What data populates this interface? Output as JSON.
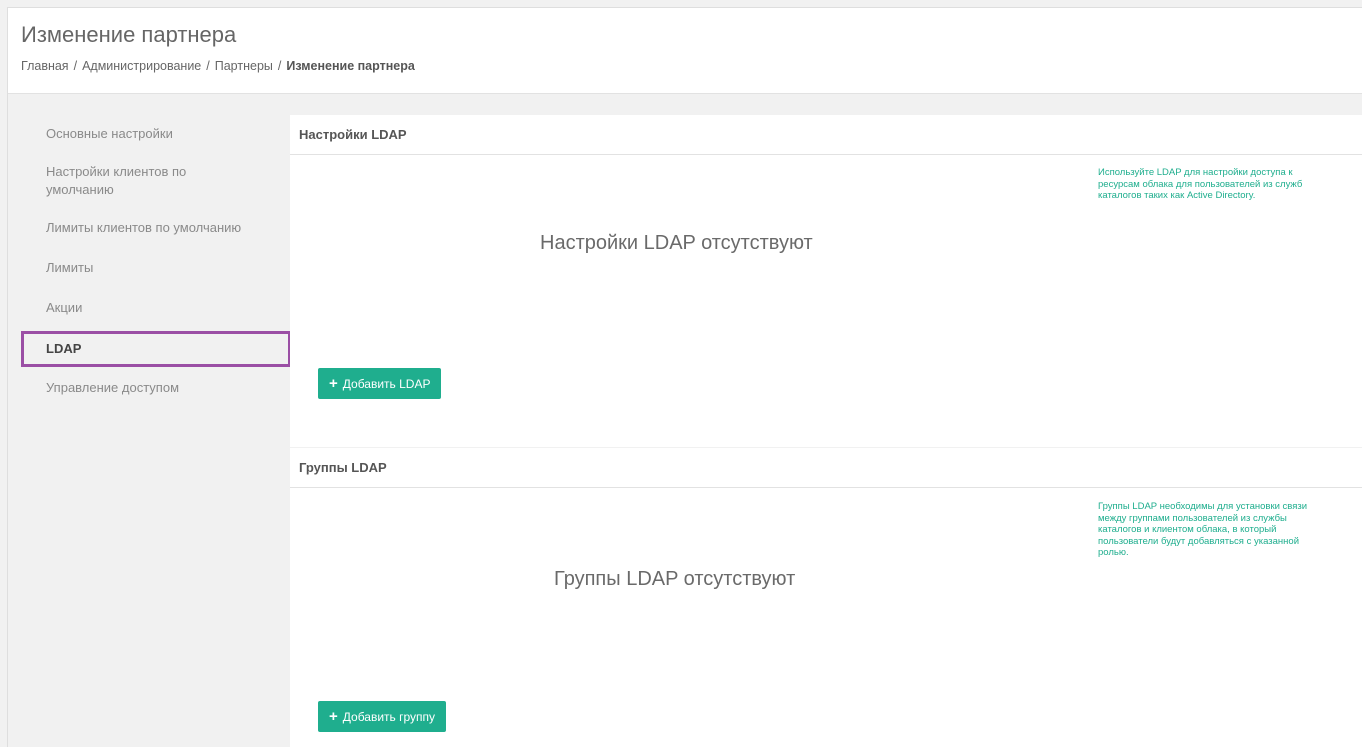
{
  "header": {
    "title": "Изменение партнера",
    "breadcrumb": [
      "Главная",
      "Администрирование",
      "Партнеры"
    ],
    "breadcrumb_current": "Изменение партнера",
    "breadcrumb_separator": "/"
  },
  "sidebar": {
    "items": [
      {
        "label": "Основные настройки"
      },
      {
        "label": "Настройки клиентов по умолчанию"
      },
      {
        "label": "Лимиты клиентов по умолчанию"
      },
      {
        "label": "Лимиты"
      },
      {
        "label": "Акции"
      },
      {
        "label": "LDAP",
        "active": true
      },
      {
        "label": "Управление доступом"
      }
    ]
  },
  "ldap_settings": {
    "title": "Настройки LDAP",
    "empty_text": "Настройки LDAP отсутствуют",
    "hint": "Используйте LDAP для настройки доступа к ресурсам облака для пользователей из служб каталогов таких как Active Directory.",
    "add_button": "Добавить LDAP"
  },
  "ldap_groups": {
    "title": "Группы LDAP",
    "empty_text": "Группы LDAP отсутствуют",
    "hint": "Группы LDAP необходимы для установки связи между группами пользователей из службы каталогов и клиентом облака, в который пользователи будут добавляться с указанной ролью.",
    "add_button": "Добавить группу"
  },
  "colors": {
    "accent": "#1fae8e",
    "active_outline": "#9b4fa5"
  }
}
